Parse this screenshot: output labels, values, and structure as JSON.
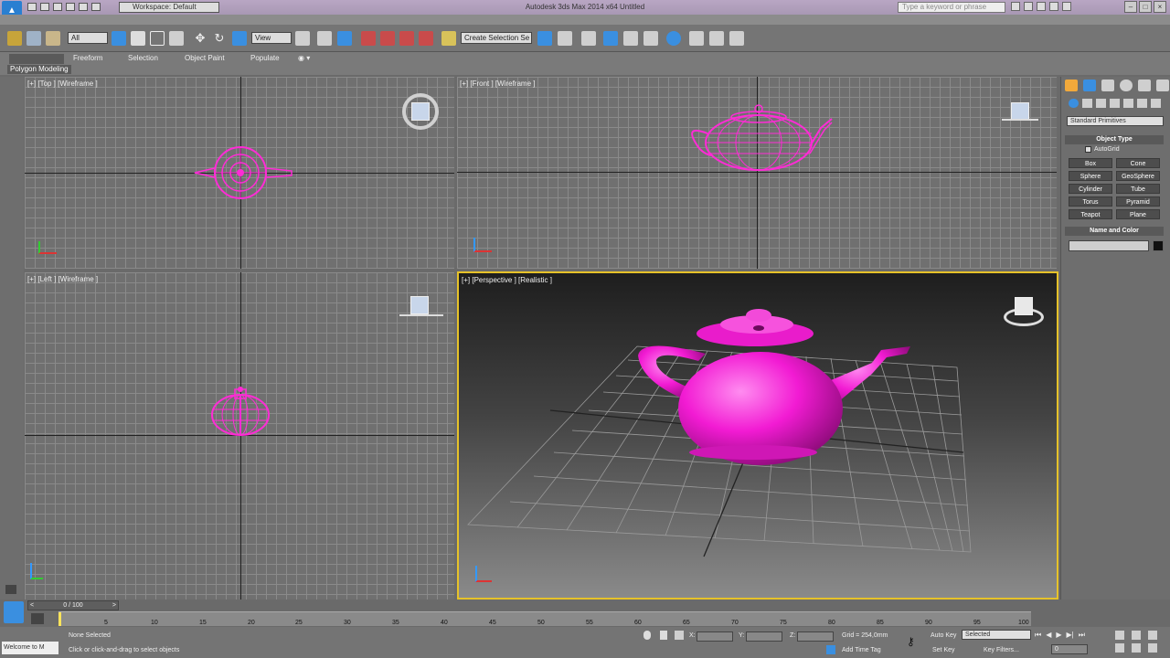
{
  "titlebar": {
    "workspace": "Workspace: Default",
    "title": "Autodesk 3ds Max 2014 x64    Untitled",
    "search_placeholder": "Type a keyword or phrase"
  },
  "toolbar": {
    "filter_value": "All",
    "view_value": "View",
    "selection_set": "Create Selection Se"
  },
  "ribbon": {
    "tabs": [
      "Freeform",
      "Selection",
      "Object Paint",
      "Populate"
    ],
    "panel_label": "Polygon Modeling"
  },
  "viewports": {
    "top": "[+] [Top ] [Wireframe ]",
    "front": "[+] [Front ] [Wireframe ]",
    "left": "[+] [Left ] [Wireframe ]",
    "perspective": "[+] [Perspective ] [Realistic ]"
  },
  "command_panel": {
    "dropdown": "Standard Primitives",
    "object_type_title": "Object Type",
    "autogrid": "AutoGrid",
    "primitives": [
      "Box",
      "Cone",
      "Sphere",
      "GeoSphere",
      "Cylinder",
      "Tube",
      "Torus",
      "Pyramid",
      "Teapot",
      "Plane"
    ],
    "name_color_title": "Name and Color"
  },
  "timeline": {
    "frame_counter": "0 / 100",
    "ticks": [
      "5",
      "10",
      "15",
      "20",
      "25",
      "30",
      "35",
      "40",
      "45",
      "50",
      "55",
      "60",
      "65",
      "70",
      "75",
      "80",
      "85",
      "90",
      "95",
      "100"
    ]
  },
  "status": {
    "welcome": "Welcome to M",
    "selection": "None Selected",
    "prompt": "Click or click-and-drag to select objects",
    "x_label": "X:",
    "y_label": "Y:",
    "z_label": "Z:",
    "grid": "Grid = 254,0mm",
    "add_time_tag": "Add Time Tag",
    "auto_key": "Auto Key",
    "set_key": "Set Key",
    "selected": "Selected",
    "key_filters": "Key Filters...",
    "frame_value": "0"
  },
  "colors": {
    "accent": "#ff2bd6",
    "active_border": "#e6c229"
  }
}
